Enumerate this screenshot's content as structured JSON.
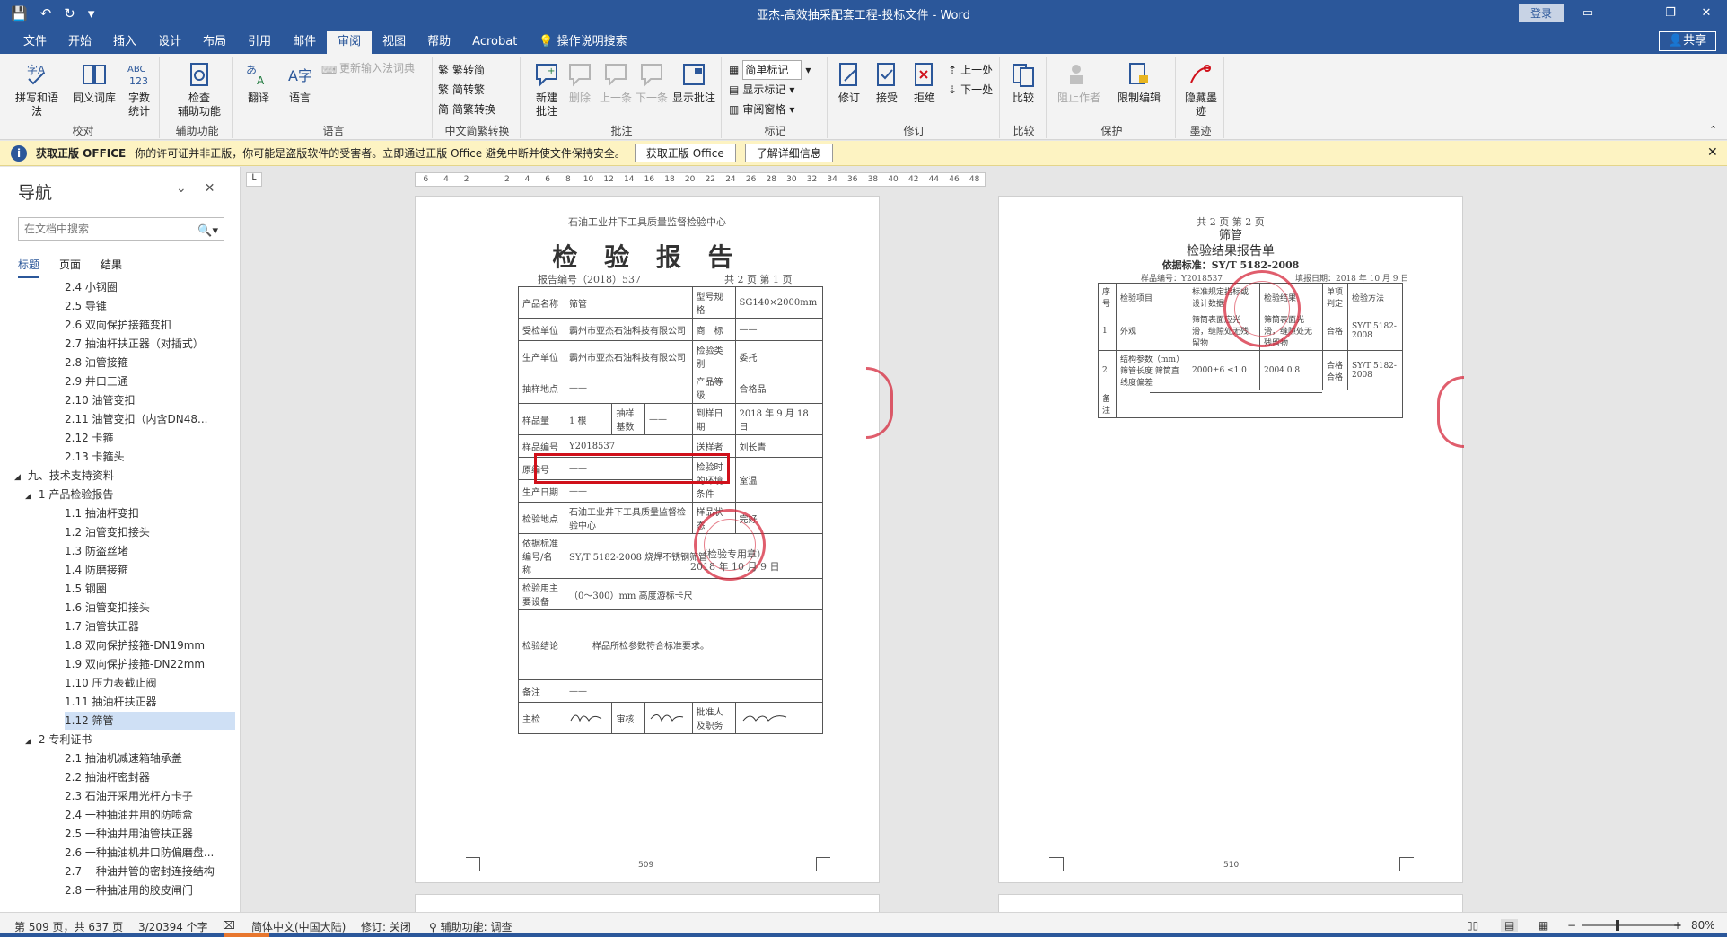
{
  "titlebar": {
    "title": "亚杰-高效抽采配套工程-投标文件  -  Word",
    "login": "登录",
    "share": "共享"
  },
  "menu": [
    "文件",
    "开始",
    "插入",
    "设计",
    "布局",
    "引用",
    "邮件",
    "审阅",
    "视图",
    "帮助",
    "Acrobat",
    "操作说明搜索"
  ],
  "ribbon": {
    "proofing": {
      "label": "校对",
      "spelling": "拼写和语法",
      "thesaurus": "同义词库",
      "wordcount_1": "字数",
      "wordcount_2": "统计"
    },
    "accessibility": {
      "label": "辅助功能",
      "check_1": "检查",
      "check_2": "辅助功能"
    },
    "language": {
      "label": "语言",
      "translate": "翻译",
      "language": "语言",
      "ime": "更新输入法词典"
    },
    "chinese": {
      "label": "中文简繁转换",
      "to_simp": "繁转简",
      "to_trad": "简转繁",
      "convert": "简繁转换"
    },
    "comments": {
      "label": "批注",
      "new_1": "新建",
      "new_2": "批注",
      "delete": "删除",
      "prev": "上一条",
      "next": "下一条",
      "show": "显示批注"
    },
    "tracking": {
      "label": "标记",
      "simple": "简单标记",
      "show_markup": "显示标记",
      "pane": "审阅窗格"
    },
    "changes": {
      "label": "修订",
      "track": "修订",
      "accept": "接受",
      "reject": "拒绝",
      "prev": "上一处",
      "next": "下一处"
    },
    "compare": {
      "label": "比较",
      "compare": "比较"
    },
    "protect": {
      "label": "保护",
      "block": "阻止作者",
      "restrict": "限制编辑"
    },
    "ink": {
      "label": "墨迹",
      "hide_1": "隐藏墨",
      "hide_2": "迹"
    }
  },
  "notice": {
    "title": "获取正版 OFFICE",
    "message": "你的许可证并非正版，你可能是盗版软件的受害者。立即通过正版 Office 避免中断并使文件保持安全。",
    "btn_get": "获取正版 Office",
    "btn_more": "了解详细信息"
  },
  "nav": {
    "title": "导航",
    "search_placeholder": "在文档中搜索",
    "tabs": [
      "标题",
      "页面",
      "结果"
    ],
    "items": [
      {
        "text": "2.4 小钢圈",
        "level": 3
      },
      {
        "text": "2.5 导锥",
        "level": 3
      },
      {
        "text": "2.6 双向保护接箍变扣",
        "level": 3
      },
      {
        "text": "2.7 抽油杆扶正器（对插式）",
        "level": 3
      },
      {
        "text": "2.8 油管接箍",
        "level": 3
      },
      {
        "text": "2.9 井口三通",
        "level": 3
      },
      {
        "text": "2.10 油管变扣",
        "level": 3
      },
      {
        "text": "2.11 油管变扣（内含DN48...",
        "level": 3
      },
      {
        "text": "2.12 卡箍",
        "level": 3
      },
      {
        "text": "2.13 卡箍头",
        "level": 3
      },
      {
        "text": "九、技术支持资料",
        "level": 1
      },
      {
        "text": "1 产品检验报告",
        "level": 2
      },
      {
        "text": "1.1 抽油杆变扣",
        "level": 3
      },
      {
        "text": "1.2 油管变扣接头",
        "level": 3
      },
      {
        "text": "1.3 防盗丝堵",
        "level": 3
      },
      {
        "text": "1.4 防磨接箍",
        "level": 3
      },
      {
        "text": "1.5 钢圈",
        "level": 3
      },
      {
        "text": "1.6 油管变扣接头",
        "level": 3
      },
      {
        "text": "1.7 油管扶正器",
        "level": 3
      },
      {
        "text": "1.8 双向保护接箍-DN19mm",
        "level": 3
      },
      {
        "text": "1.9 双向保护接箍-DN22mm",
        "level": 3
      },
      {
        "text": "1.10 压力表截止阀",
        "level": 3
      },
      {
        "text": "1.11 抽油杆扶正器",
        "level": 3
      },
      {
        "text": "1.12 筛管",
        "level": 3
      },
      {
        "text": "2 专利证书",
        "level": 2
      },
      {
        "text": "2.1 抽油机减速箱轴承盖",
        "level": 3
      },
      {
        "text": "2.2 抽油杆密封器",
        "level": 3
      },
      {
        "text": "2.3 石油开采用光杆方卡子",
        "level": 3
      },
      {
        "text": "2.4 一种抽油井用的防喷盒",
        "level": 3
      },
      {
        "text": "2.5 一种油井用油管扶正器",
        "level": 3
      },
      {
        "text": "2.6 一种抽油机井口防偏磨盘...",
        "level": 3
      },
      {
        "text": "2.7 一种油井管的密封连接结构",
        "level": 3
      },
      {
        "text": "2.8 一种抽油用的胶皮闸门",
        "level": 3
      }
    ]
  },
  "ruler": [
    "6",
    "4",
    "2",
    "",
    "2",
    "4",
    "6",
    "8",
    "10",
    "12",
    "14",
    "16",
    "18",
    "20",
    "22",
    "24",
    "26",
    "28",
    "30",
    "32",
    "34",
    "36",
    "38",
    "40",
    "42",
    "44",
    "46",
    "48"
  ],
  "page1": {
    "center": "石油工业井下工具质量监督检验中心",
    "title": "检 验 报 告",
    "report_no": "报告编号（2018）537",
    "page_info": "共 2 页 第 1 页",
    "rows": [
      [
        "产品名称",
        "筛管",
        "型号规格",
        "SG140×2000mm"
      ],
      [
        "受检单位",
        "霸州市亚杰石油科技有限公司",
        "商　标",
        "——"
      ],
      [
        "生产单位",
        "霸州市亚杰石油科技有限公司",
        "检验类别",
        "委托"
      ],
      [
        "抽样地点",
        "——",
        "产品等级",
        "合格品"
      ],
      [
        "样品量",
        "1 根",
        "到样日期",
        "2018 年 9 月 18 日"
      ],
      [
        "样品编号",
        "Y2018537",
        "送样者",
        "刘长青"
      ],
      [
        "原编号",
        "——",
        "检验时的环境条件",
        "室温"
      ],
      [
        "生产日期",
        "——",
        "",
        ""
      ],
      [
        "检验地点",
        "石油工业井下工具质量监督检验中心",
        "样品状态",
        "完好"
      ],
      [
        "依据标准编号/名称",
        "SY/T 5182-2008 烧焊不锈钢筛管",
        "",
        ""
      ],
      [
        "检验用主要设备",
        "（0～300）mm 高度游标卡尺",
        "",
        ""
      ],
      [
        "检验结论",
        "样品所检参数符合标准要求。",
        "",
        ""
      ],
      [
        "备注",
        "——",
        "",
        ""
      ]
    ],
    "sample_base": "抽样基数",
    "stamp_text": "（检验专用章）",
    "stamp_date": "2018 年 10 月 9 日",
    "sign": {
      "main": "主检",
      "review": "审核",
      "approve": "批准人及职务"
    },
    "page_no": "509"
  },
  "page2": {
    "page_info": "共 2 页 第 2 页",
    "product": "筛管",
    "title": "检验结果报告单",
    "standard": "依据标准：SY/T 5182-2008",
    "report_no": "样品编号：Y2018537",
    "date": "填报日期：2018 年 10 月 9 日",
    "headers": [
      "序号",
      "检验项目",
      "标准规定指标或设计数据",
      "检验结果",
      "单项判定",
      "检验方法"
    ],
    "rows": [
      [
        "1",
        "外观",
        "筛筒表面应光滑，缝隙处无残留物",
        "筛筒表面光滑，缝隙处无残留物",
        "合格",
        "SY/T 5182-2008"
      ],
      [
        "2",
        "结构参数（mm）筛管长度 筛筒直线度偏差",
        "2000±6  ≤1.0",
        "2004  0.8",
        "合格 合格",
        "SY/T 5182-2008"
      ],
      [
        "备注",
        "",
        "",
        "",
        "",
        ""
      ]
    ],
    "page_no": "510"
  },
  "status": {
    "page": "第 509 页，共 637 页",
    "words": "3/20394 个字",
    "lang": "简体中文(中国大陆)",
    "track": "修订: 关闭",
    "access": "辅助功能: 调查",
    "zoom": "80%"
  }
}
